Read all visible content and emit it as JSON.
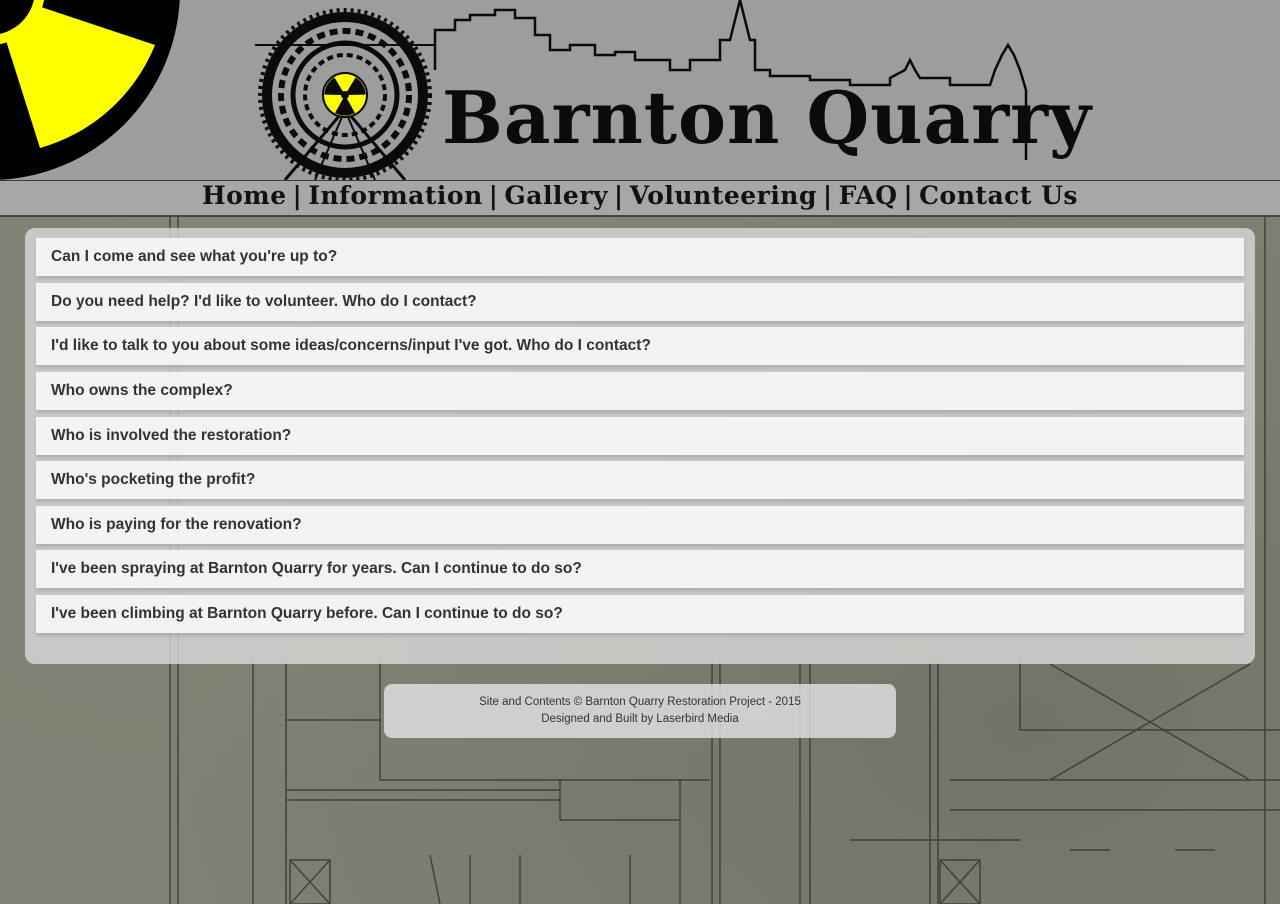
{
  "site": {
    "logo_text": "Barnton Quarry"
  },
  "nav": {
    "items": [
      {
        "label": "Home"
      },
      {
        "label": "Information"
      },
      {
        "label": "Gallery"
      },
      {
        "label": "Volunteering"
      },
      {
        "label": "FAQ"
      },
      {
        "label": "Contact Us"
      }
    ],
    "separator": "|"
  },
  "faq": {
    "questions": [
      {
        "text": "Can I come and see what you're up to?"
      },
      {
        "text": "Do you need help? I'd like to volunteer. Who do I contact?"
      },
      {
        "text": "I'd like to talk to you about some ideas/concerns/input I've got. Who do I contact?"
      },
      {
        "text": "Who owns the complex?"
      },
      {
        "text": "Who is involved the restoration?"
      },
      {
        "text": "Who's pocketing the profit?"
      },
      {
        "text": "Who is paying for the renovation?"
      },
      {
        "text": "I've been spraying at Barnton Quarry for years. Can I continue to do so?"
      },
      {
        "text": "I've been climbing at Barnton Quarry before. Can I continue to do so?"
      }
    ]
  },
  "footer": {
    "copyright": "Site and Contents © Barnton Quarry Restoration Project - 2015",
    "credit": "Designed and Built by Laserbird Media"
  },
  "colors": {
    "hazard_yellow": "#ffff00",
    "header_bg": "#9d9d9d",
    "panel_bg": "#dcdcdc",
    "item_bg": "#f3f3f4"
  },
  "icons": {
    "hazard_corner": "radiation-hazard-icon",
    "logo_emblem": "radiation-tunnel-icon"
  }
}
